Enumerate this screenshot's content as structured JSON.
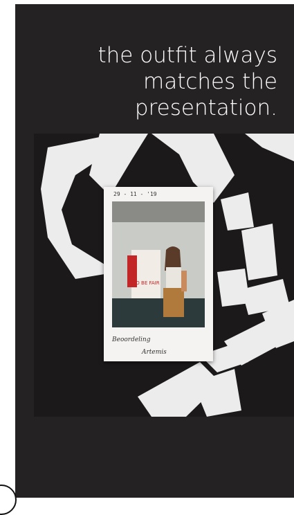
{
  "headline": "the outfit always matches the presentation.",
  "polaroid": {
    "date": "29 - 11 - '19",
    "caption_line1": "Beoordeling",
    "caption_line2": "Artemis",
    "poster_text": "TO BE FAIR"
  },
  "colors": {
    "card_background": "#252223",
    "text": "#ffffff"
  }
}
